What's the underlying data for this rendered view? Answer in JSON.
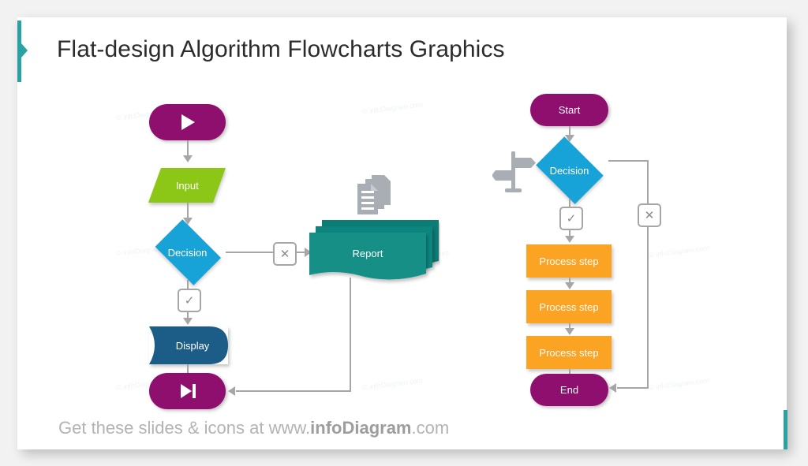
{
  "slide": {
    "title": "Flat-design Algorithm Flowcharts Graphics",
    "footer_prefix": "Get these slides & icons at www.",
    "footer_brand": "infoDiagram",
    "footer_suffix": ".com",
    "watermark": "© infoDiagram.com"
  },
  "colors": {
    "accent_teal": "#2aa1a3",
    "purple": "#8e0f6e",
    "green": "#8cc718",
    "blue_light": "#17a2d8",
    "blue_dark": "#1c5d87",
    "teal_report": "#128f86",
    "teal_report_dark": "#0f7b74",
    "orange": "#fba323",
    "connector_gray": "#a6a6a6",
    "icon_gray": "#a9aeb5",
    "title_text": "#2b2b2b",
    "footer_text": "#b3b3b3"
  },
  "flowchart_left": {
    "name": "left-flowchart",
    "nodes": [
      {
        "id": "start",
        "label": "",
        "shape": "terminator",
        "icon": "play-icon",
        "color": "#8e0f6e"
      },
      {
        "id": "input",
        "label": "Input",
        "shape": "parallelogram",
        "icon": "",
        "color": "#8cc718"
      },
      {
        "id": "decision",
        "label": "Decision",
        "shape": "diamond",
        "icon": "",
        "color": "#17a2d8"
      },
      {
        "id": "report",
        "label": "Report",
        "shape": "multidocument",
        "icon": "",
        "color": "#128f86"
      },
      {
        "id": "display",
        "label": "Display",
        "shape": "display",
        "icon": "",
        "color": "#1c5d87"
      },
      {
        "id": "end",
        "label": "",
        "shape": "terminator",
        "icon": "skip-end-icon",
        "color": "#8e0f6e"
      }
    ],
    "markers": [
      {
        "id": "no-marker-left",
        "glyph": "✕",
        "name": "no-marker"
      },
      {
        "id": "yes-marker-left",
        "glyph": "✓",
        "name": "yes-marker"
      }
    ],
    "decorative_icons": [
      {
        "name": "documents-icon"
      }
    ]
  },
  "flowchart_right": {
    "name": "right-flowchart",
    "nodes": [
      {
        "id": "start",
        "label": "Start",
        "shape": "terminator",
        "color": "#8e0f6e"
      },
      {
        "id": "decision",
        "label": "Decision",
        "shape": "diamond",
        "color": "#17a2d8"
      },
      {
        "id": "step1",
        "label": "Process step",
        "shape": "process",
        "color": "#fba323"
      },
      {
        "id": "step2",
        "label": "Process step",
        "shape": "process",
        "color": "#fba323"
      },
      {
        "id": "step3",
        "label": "Process step",
        "shape": "process",
        "color": "#fba323"
      },
      {
        "id": "end",
        "label": "End",
        "shape": "terminator",
        "color": "#8e0f6e"
      }
    ],
    "markers": [
      {
        "id": "yes-marker-right",
        "glyph": "✓",
        "name": "yes-marker"
      },
      {
        "id": "no-marker-right",
        "glyph": "✕",
        "name": "no-marker"
      }
    ],
    "decorative_icons": [
      {
        "name": "signpost-icon"
      }
    ]
  }
}
